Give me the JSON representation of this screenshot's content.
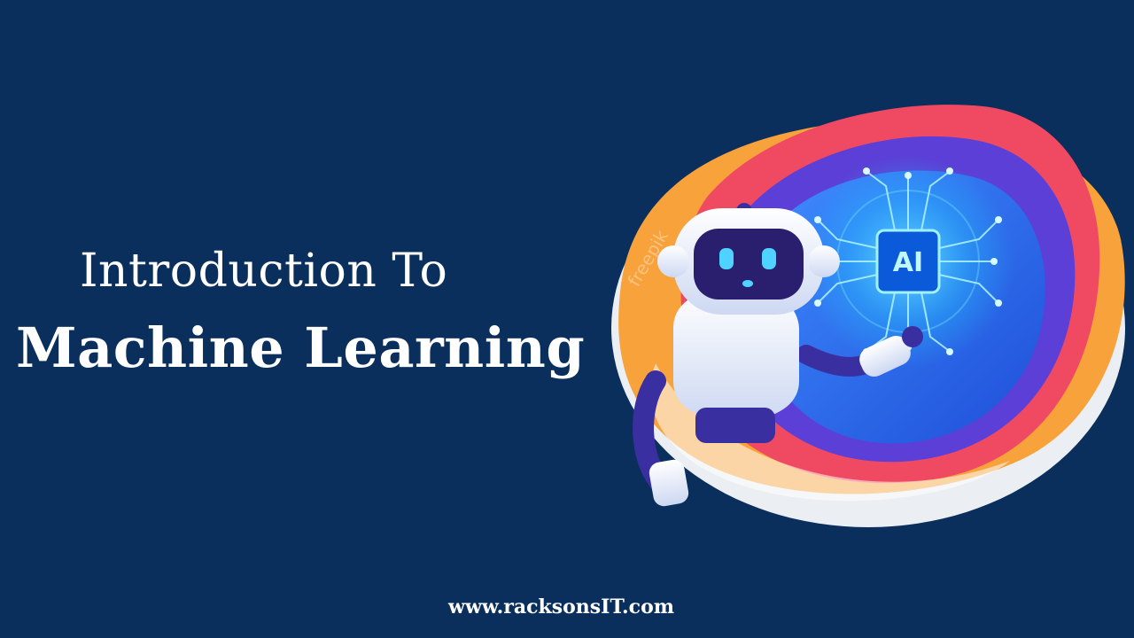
{
  "title": {
    "line1": "Introduction To",
    "line2": "Machine Learning"
  },
  "footer": {
    "website": "www.racksonsIT.com"
  },
  "illustration": {
    "chip_label": "AI",
    "watermark": "freepik"
  },
  "colors": {
    "background": "#0a2f5c",
    "text": "#ffffff",
    "blob_red": "#f04a63",
    "blob_orange": "#f7a23a",
    "blob_blue": "#2f6cf0",
    "blob_purple": "#5b3fd6",
    "chip_glow": "#23c7ff"
  }
}
